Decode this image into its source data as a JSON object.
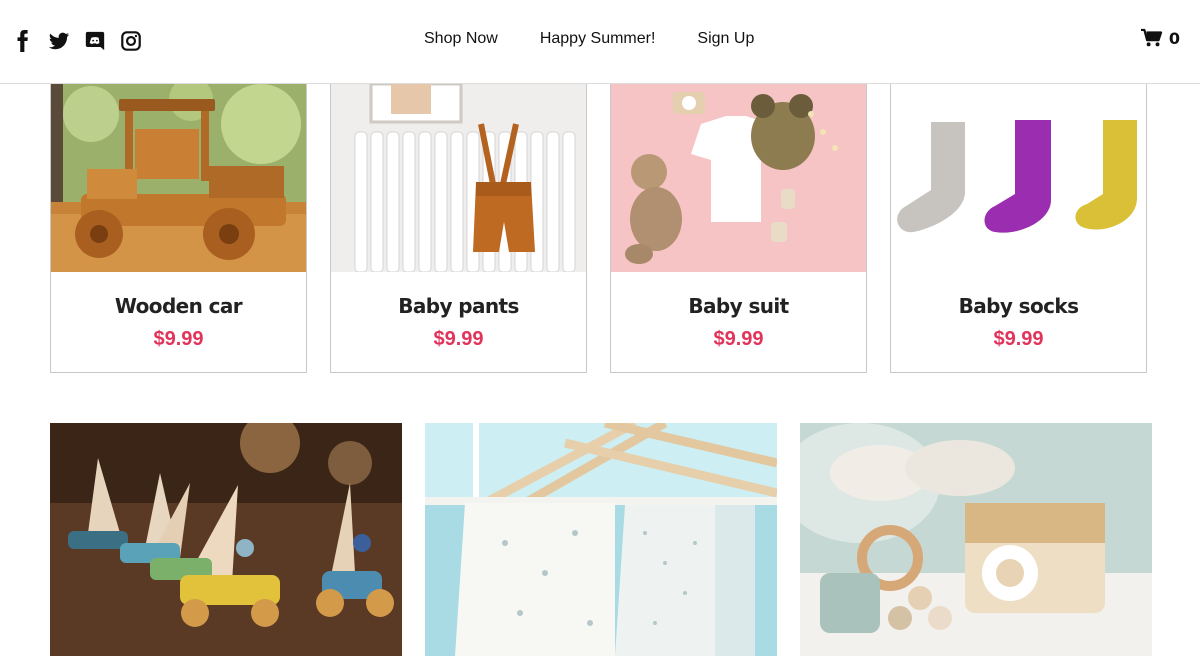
{
  "header": {
    "social_icons": [
      "facebook-icon",
      "twitter-icon",
      "discord-icon",
      "instagram-icon"
    ],
    "nav": [
      {
        "label": "Shop Now",
        "active": true
      },
      {
        "label": "Happy Summer!",
        "active": false
      },
      {
        "label": "Sign Up",
        "active": false
      }
    ],
    "cart": {
      "icon": "cart-icon",
      "count": "0"
    }
  },
  "products": [
    {
      "name": "Wooden car",
      "price": "$9.99"
    },
    {
      "name": "Baby pants",
      "price": "$9.99"
    },
    {
      "name": "Baby suit",
      "price": "$9.99"
    },
    {
      "name": "Baby socks",
      "price": "$9.99"
    }
  ],
  "colors": {
    "price": "#e2335b",
    "text": "#111111",
    "border": "#c9c9c9"
  }
}
